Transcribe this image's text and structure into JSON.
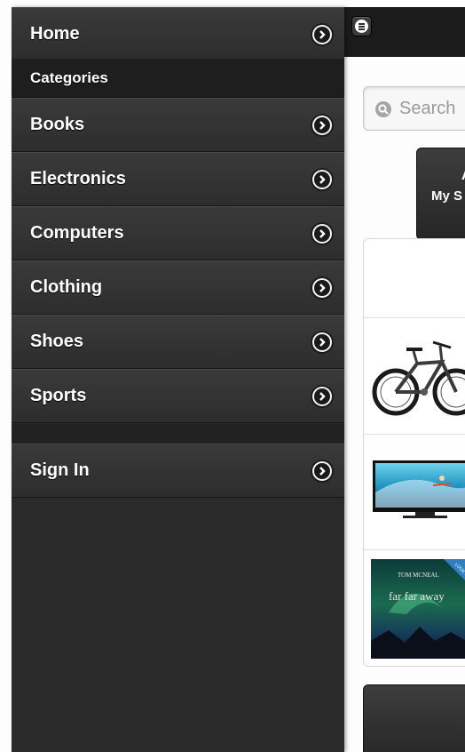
{
  "panel": {
    "home_label": "Home",
    "categories_heading": "Categories",
    "categories": [
      {
        "label": "Books"
      },
      {
        "label": "Electronics"
      },
      {
        "label": "Computers"
      },
      {
        "label": "Clothing"
      },
      {
        "label": "Shoes"
      },
      {
        "label": "Sports"
      }
    ],
    "sign_in_label": "Sign In"
  },
  "main": {
    "search": {
      "placeholder": "Search"
    },
    "store_button": {
      "letter": "A",
      "label": "My S"
    },
    "products": [
      {
        "image": "mountain-bike-image"
      },
      {
        "image": "flat-screen-tv-image"
      },
      {
        "image": "book-cover-image",
        "cover_author": "TOM MCNEAL",
        "cover_title": "far far away",
        "corner_badge": "LOOK INSIDE"
      }
    ]
  },
  "colors": {
    "panel_background": "#2a2a2a",
    "header_background": "#1b1b1b",
    "page_background": "#fdfdfd"
  }
}
